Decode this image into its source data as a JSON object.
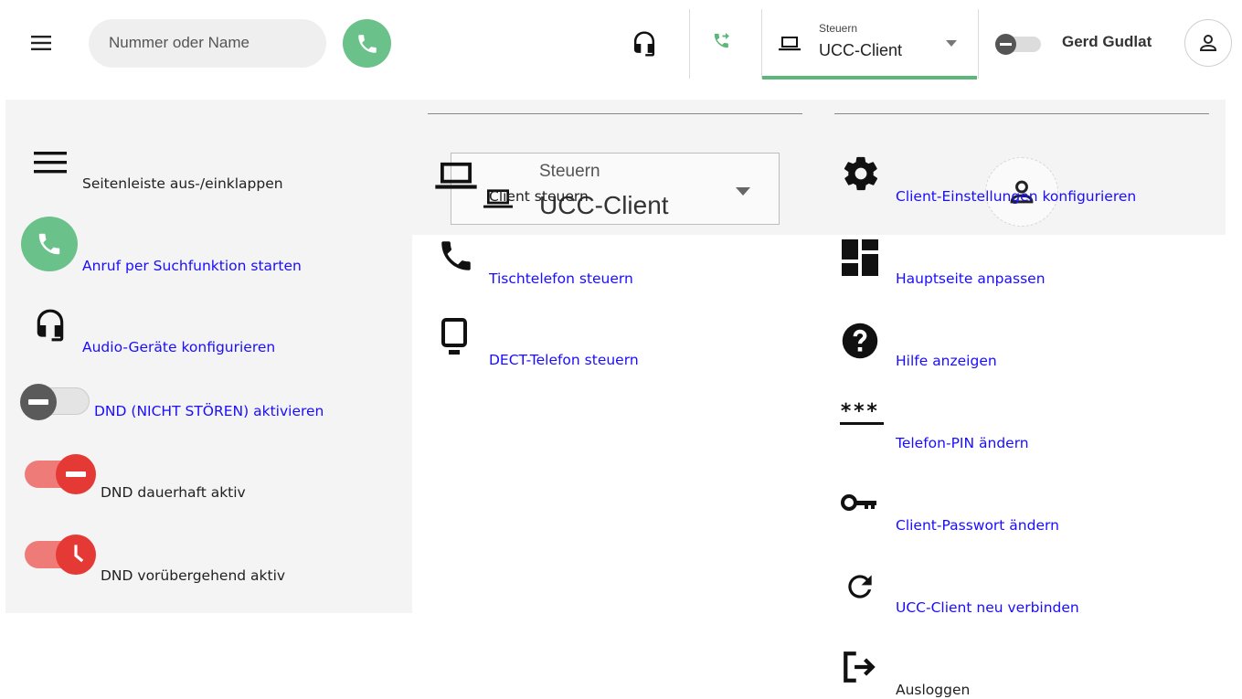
{
  "topbar": {
    "search_placeholder": "Nummer oder Name",
    "steuern_label": "Steuern",
    "client_value": "UCC-Client",
    "user_name": "Gerd Gudlat"
  },
  "legend_left": {
    "sidebar_toggle": "Seitenleiste aus-/einklappen",
    "start_call": "Anruf per Suchfunktion starten",
    "audio_devices": "Audio-Geräte konfigurieren",
    "dnd_activate": "DND (NICHT STÖREN) aktivieren",
    "dnd_permanent": "DND dauerhaft aktiv",
    "dnd_temporary": "DND vorübergehend aktiv"
  },
  "legend_mid": {
    "dropdown_label": "Steuern",
    "dropdown_value": "UCC-Client",
    "client_control": "Client steuern",
    "desk_phone": "Tischtelefon steuern",
    "dect_phone": "DECT-Telefon steuern"
  },
  "legend_right": {
    "client_settings": "Client-Einstellungen konfigurieren",
    "customize_main": "Hauptseite anpassen",
    "show_help": "Hilfe anzeigen",
    "pin_mask": "***",
    "change_pin": "Telefon-PIN ändern",
    "change_password": "Client-Passwort ändern",
    "reconnect": "UCC-Client neu verbinden",
    "logout": "Ausloggen"
  },
  "colors": {
    "call_green": "#6bc18a",
    "dnd_red": "#e53935",
    "dnd_track": "#ef7b78",
    "link_blue": "#1a0dff",
    "tab_underline": "#5cb87a"
  },
  "icons": [
    "menu-icon",
    "phone-icon",
    "headset-icon",
    "call-forward-icon",
    "laptop-icon",
    "chevron-down-icon",
    "avatar-icon",
    "gear-icon",
    "dashboard-icon",
    "help-icon",
    "pin-icon",
    "key-icon",
    "refresh-icon",
    "logout-icon",
    "clock-icon",
    "deskphone-icon",
    "dect-phone-icon"
  ]
}
